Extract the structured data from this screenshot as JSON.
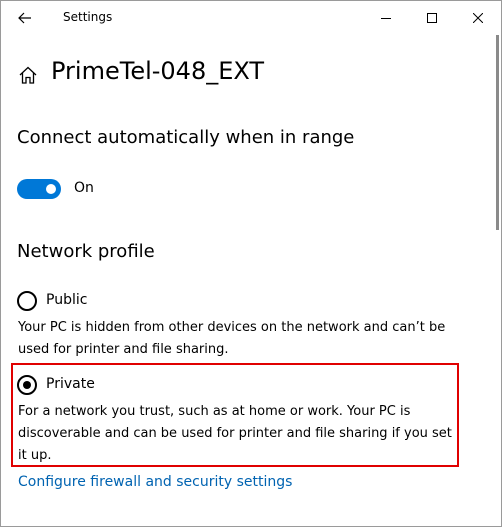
{
  "window": {
    "title": "Settings"
  },
  "page": {
    "title": "PrimeTel-048_EXT"
  },
  "connect": {
    "heading": "Connect automatically when in range",
    "toggle_state": "On",
    "toggle_on": true,
    "accent_color": "#0078d7"
  },
  "profile": {
    "heading": "Network profile",
    "options": [
      {
        "label": "Public",
        "selected": false,
        "description": "Your PC is hidden from other devices on the network and can’t be used for printer and file sharing."
      },
      {
        "label": "Private",
        "selected": true,
        "description": "For a network you trust, such as at home or work. Your PC is discoverable and can be used for printer and file sharing if you set it up."
      }
    ],
    "highlight_color": "#e00000"
  },
  "links": {
    "firewall": "Configure firewall and security settings",
    "link_color": "#0063b1"
  },
  "icons": {
    "back": "back-arrow-icon",
    "home": "home-icon",
    "minimize": "minimize-icon",
    "maximize": "maximize-icon",
    "close": "close-icon"
  }
}
